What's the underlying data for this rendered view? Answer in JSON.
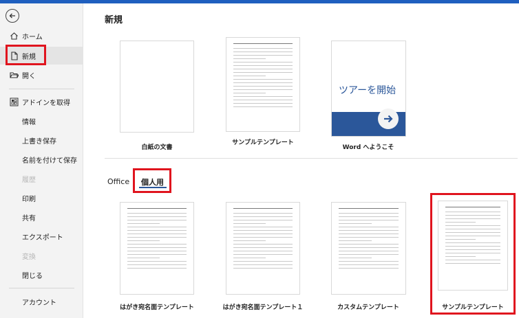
{
  "sidebar": {
    "items": [
      {
        "label": "ホーム",
        "icon": "home-icon"
      },
      {
        "label": "新規",
        "icon": "new-document-icon",
        "selected": true
      },
      {
        "label": "開く",
        "icon": "folder-open-icon"
      },
      {
        "label": "アドインを取得",
        "icon": "addins-grid-icon"
      },
      {
        "label": "情報"
      },
      {
        "label": "上書き保存"
      },
      {
        "label": "名前を付けて保存"
      },
      {
        "label": "履歴",
        "disabled": true
      },
      {
        "label": "印刷"
      },
      {
        "label": "共有"
      },
      {
        "label": "エクスポート"
      },
      {
        "label": "変換",
        "disabled": true
      },
      {
        "label": "閉じる"
      },
      {
        "label": "アカウント"
      }
    ]
  },
  "main": {
    "title": "新規",
    "featured": [
      {
        "label": "白紙の文書"
      },
      {
        "label": "サンプルテンプレート"
      },
      {
        "label": "Word へようこそ",
        "tour_text": "ツアーを開始"
      }
    ],
    "tabs": [
      {
        "label": "Office"
      },
      {
        "label": "個人用",
        "selected": true
      }
    ],
    "personal_templates": [
      {
        "label": "はがき宛名面テンプレート"
      },
      {
        "label": "はがき宛名面テンプレート１"
      },
      {
        "label": "カスタムテンプレート"
      },
      {
        "label": "サンプルテンプレート"
      }
    ]
  },
  "colors": {
    "accent": "#2b579a",
    "highlight": "#e0141e"
  }
}
